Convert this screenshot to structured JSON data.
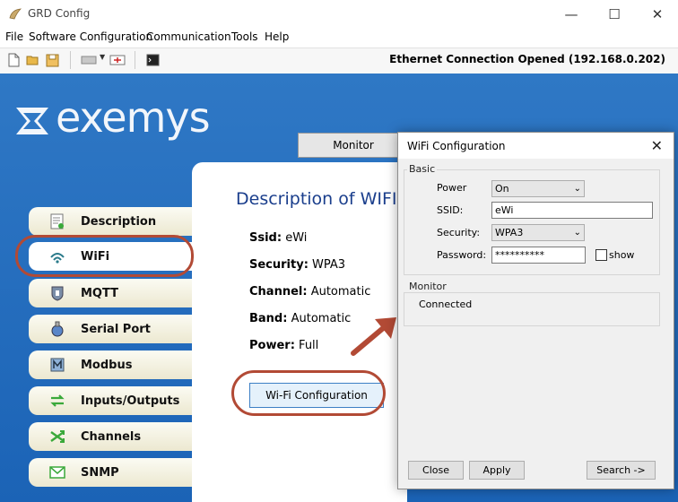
{
  "window": {
    "title": "GRD Config",
    "minimize": "—",
    "maximize": "☐",
    "close": "✕"
  },
  "menu": [
    "File",
    "Software Configuration",
    "Communication",
    "Tools",
    "Help"
  ],
  "toolbar": {
    "status": "Ethernet Connection Opened (192.168.0.202)"
  },
  "logo": {
    "text": "exemys"
  },
  "tabs": {
    "monitor": "Monitor"
  },
  "sidebar": {
    "items": [
      {
        "label": "Description",
        "icon": "description-icon"
      },
      {
        "label": "WiFi",
        "icon": "wifi-icon",
        "selected": true
      },
      {
        "label": "MQTT",
        "icon": "mqtt-icon"
      },
      {
        "label": "Serial Port",
        "icon": "serial-port-icon"
      },
      {
        "label": "Modbus",
        "icon": "modbus-icon"
      },
      {
        "label": "Inputs/Outputs",
        "icon": "inputs-outputs-icon"
      },
      {
        "label": "Channels",
        "icon": "channels-icon"
      },
      {
        "label": "SNMP",
        "icon": "snmp-icon"
      }
    ]
  },
  "main": {
    "title": "Description of WIFI",
    "props": [
      {
        "key": "Ssid:",
        "value": "eWi"
      },
      {
        "key": "Security:",
        "value": "WPA3"
      },
      {
        "key": "Channel:",
        "value": "Automatic"
      },
      {
        "key": "Band:",
        "value": "Automatic"
      },
      {
        "key": "Power:",
        "value": "Full"
      }
    ],
    "config_button": "Wi-Fi Configuration"
  },
  "dialog": {
    "title": "WiFi Configuration",
    "close": "✕",
    "basic_label": "Basic",
    "power_label": "Power",
    "power_value": "On",
    "ssid_label": "SSID:",
    "ssid_value": "eWi",
    "security_label": "Security:",
    "security_value": "WPA3",
    "password_label": "Password:",
    "password_value": "**********",
    "show_label": "show",
    "monitor_label": "Monitor",
    "monitor_status": "Connected",
    "close_button": "Close",
    "apply_button": "Apply",
    "search_button": "Search ->"
  },
  "colors": {
    "brand_blue": "#2f78c5",
    "title_blue": "#1a3e8c",
    "highlight_ring": "#b24a35"
  }
}
